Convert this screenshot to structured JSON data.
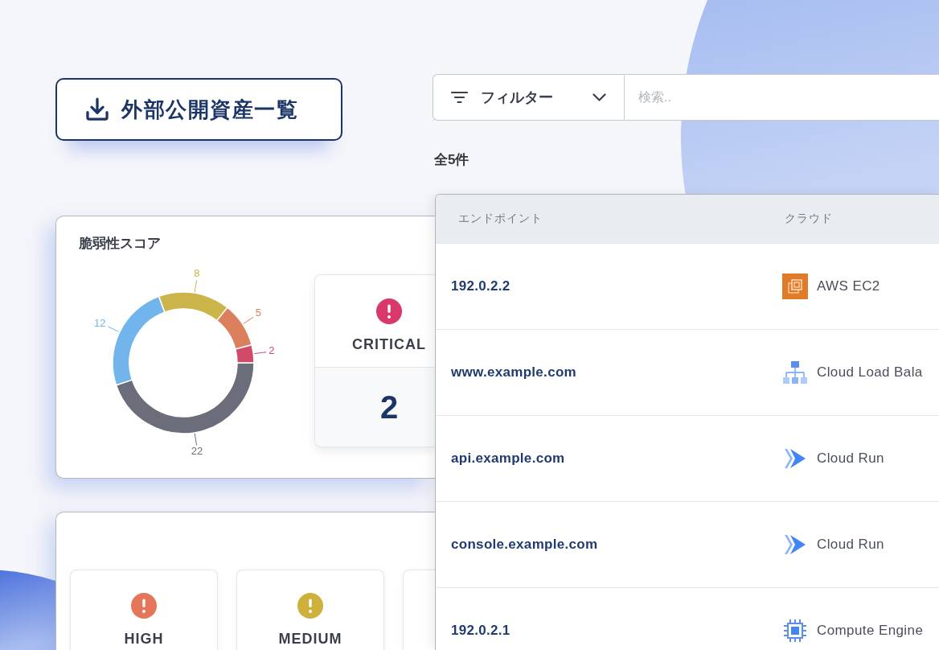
{
  "download_button": {
    "label": "外部公開資産一覧"
  },
  "filter": {
    "label": "フィルター"
  },
  "search": {
    "placeholder": "検索.."
  },
  "result_count": "全5件",
  "vulnerability_score": {
    "title": "脆弱性スコア",
    "chart_data": {
      "type": "donut",
      "values": [
        22,
        12,
        8,
        5,
        2
      ],
      "colors": [
        "#6b6d7b",
        "#72b4ec",
        "#cbb54a",
        "#dc7f5c",
        "#d24a6a"
      ],
      "data_labels": true
    },
    "severity_cards": [
      {
        "label": "CRITICAL",
        "count": "2",
        "color": "#d8386a"
      }
    ]
  },
  "severity_panel": {
    "severity_cards": [
      {
        "label": "HIGH",
        "color": "#e5765a"
      },
      {
        "label": "MEDIUM",
        "color": "#cdb13a"
      }
    ]
  },
  "table": {
    "columns": [
      "エンドポイント",
      "クラウド"
    ],
    "rows": [
      {
        "endpoint": "192.0.2.2",
        "cloud": "AWS EC2",
        "kind": "ec2"
      },
      {
        "endpoint": "www.example.com",
        "cloud": "Cloud Load Bala",
        "kind": "balancer"
      },
      {
        "endpoint": "api.example.com",
        "cloud": "Cloud Run",
        "kind": "run"
      },
      {
        "endpoint": "console.example.com",
        "cloud": "Cloud Run",
        "kind": "run"
      },
      {
        "endpoint": "192.0.2.1",
        "cloud": "Compute Engine",
        "kind": "compute"
      }
    ]
  }
}
